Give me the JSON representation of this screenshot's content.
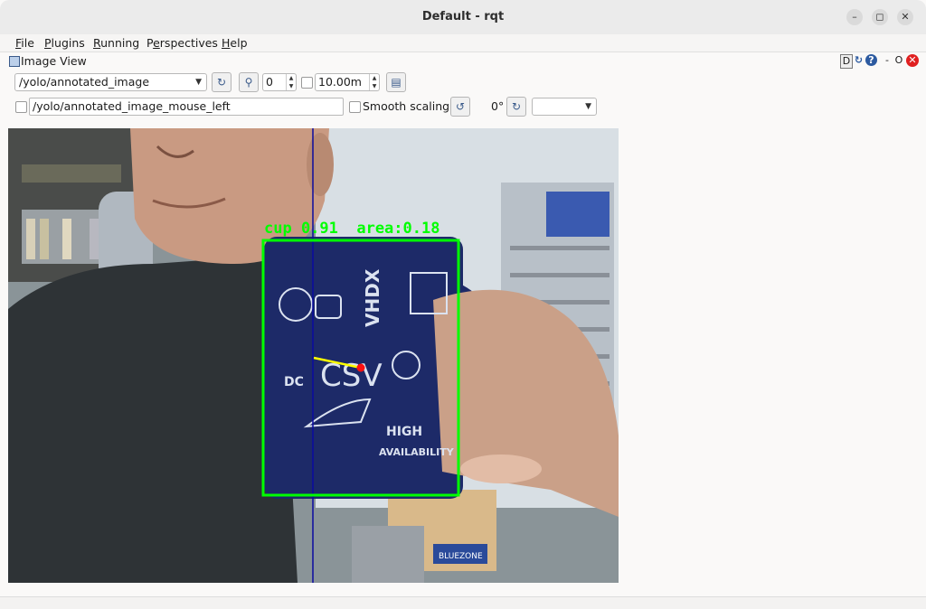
{
  "window": {
    "title": "Default - rqt"
  },
  "menu": [
    "File",
    "Plugins",
    "Running",
    "Perspectives",
    "Help"
  ],
  "menu_mnemonics": [
    "F",
    "P",
    "R",
    "e",
    "H"
  ],
  "dock": {
    "title": "Image View",
    "btn_d": "D",
    "btn_close_sep": "-",
    "btn_o": "O"
  },
  "toolbar": {
    "topic": "/yolo/annotated_image",
    "zoom_value": "0",
    "timeout_value": "10.00m",
    "mouse_topic": "/yolo/annotated_image_mouse_left",
    "smooth_label": "Smooth scaling",
    "rotation_label": "0°",
    "rotation_select": ""
  },
  "overlay": {
    "detection_label": "cup 0.91  area:0.18",
    "box_color": "#00ff00"
  },
  "scene": {
    "mug_text_1": "VHDX",
    "mug_text_2": "CSV",
    "mug_text_3": "HIGH",
    "mug_text_4": "AVAILABILITY",
    "mug_text_5": "DC",
    "box_text": "BLUEZONE"
  },
  "icons": {
    "minimize": "minimize-icon",
    "maximize": "maximize-icon",
    "close": "close-icon",
    "refresh": "refresh-icon",
    "zoom_reset": "zoom-icon",
    "save": "save-icon",
    "rotate_left": "rotate-left-icon",
    "rotate_right": "rotate-right-icon"
  }
}
